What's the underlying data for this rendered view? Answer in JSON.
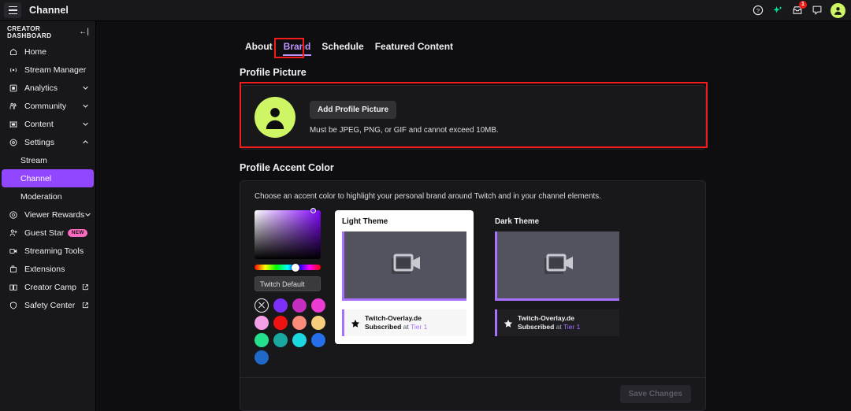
{
  "topbar": {
    "title": "Channel",
    "menu_icon": "hamburger-icon",
    "icons": [
      {
        "name": "help-icon",
        "label": "Help"
      },
      {
        "name": "sparkle-icon",
        "label": "Prime Loot"
      },
      {
        "name": "inbox-icon",
        "label": "Inbox",
        "badge": "1"
      },
      {
        "name": "whispers-icon",
        "label": "Whispers"
      }
    ],
    "avatar_bg": "#cdf564"
  },
  "sidebar": {
    "heading": "CREATOR DASHBOARD",
    "collapse_icon": "collapse-left-icon",
    "items": [
      {
        "label": "Home",
        "icon": "home-icon",
        "expandable": false
      },
      {
        "label": "Stream Manager",
        "icon": "broadcast-icon",
        "expandable": false
      },
      {
        "label": "Analytics",
        "icon": "analytics-icon",
        "expandable": true
      },
      {
        "label": "Community",
        "icon": "community-icon",
        "expandable": true
      },
      {
        "label": "Content",
        "icon": "content-icon",
        "expandable": true
      },
      {
        "label": "Settings",
        "icon": "gear-icon",
        "expandable": true,
        "expanded": true
      }
    ],
    "settings_children": [
      {
        "label": "Stream",
        "active": false
      },
      {
        "label": "Channel",
        "active": true
      },
      {
        "label": "Moderation",
        "active": false
      }
    ],
    "items_after": [
      {
        "label": "Viewer Rewards",
        "icon": "rewards-icon",
        "expandable": true
      },
      {
        "label": "Guest Star",
        "icon": "guest-star-icon",
        "badge": "NEW"
      },
      {
        "label": "Streaming Tools",
        "icon": "camera-icon"
      },
      {
        "label": "Extensions",
        "icon": "extensions-icon"
      },
      {
        "label": "Creator Camp",
        "icon": "book-icon",
        "external": true
      },
      {
        "label": "Safety Center",
        "icon": "shield-icon",
        "external": true
      }
    ],
    "active_bg": "#9147ff",
    "new_badge_bg": "#ff6ac1"
  },
  "tabs": [
    {
      "label": "About",
      "active": false
    },
    {
      "label": "Brand",
      "active": true
    },
    {
      "label": "Schedule",
      "active": false
    },
    {
      "label": "Featured Content",
      "active": false
    }
  ],
  "profile_picture": {
    "section_title": "Profile Picture",
    "button_label": "Add Profile Picture",
    "hint": "Must be JPEG, PNG, or GIF and cannot exceed 10MB.",
    "avatar_bg": "#cdf564"
  },
  "accent_color": {
    "section_title": "Profile Accent Color",
    "description": "Choose an accent color to highlight your personal brand around Twitch and in your channel elements.",
    "input_value": "Twitch Default",
    "swatches": [
      {
        "name": "no-color",
        "color": "none",
        "selected": true
      },
      {
        "name": "purple",
        "color": "#7b2ff7"
      },
      {
        "name": "magenta-purple",
        "color": "#c42ec0"
      },
      {
        "name": "pink-magenta",
        "color": "#ee3bd1"
      },
      {
        "name": "light-pink",
        "color": "#f39fe8"
      },
      {
        "name": "red",
        "color": "#ee1212"
      },
      {
        "name": "salmon",
        "color": "#f88b7a"
      },
      {
        "name": "light-orange",
        "color": "#f7ce7c"
      },
      {
        "name": "spring-green",
        "color": "#22e08c"
      },
      {
        "name": "teal",
        "color": "#1aa7a0"
      },
      {
        "name": "cyan",
        "color": "#1ad7e0"
      },
      {
        "name": "blue",
        "color": "#2570e8"
      },
      {
        "name": "dark-blue",
        "color": "#2169c9"
      }
    ],
    "accent_preview_color": "#a970ff",
    "themes": [
      {
        "label": "Light Theme",
        "mode": "light",
        "notif_title": "Twitch-Overlay.de",
        "notif_sub_bold": "Subscribed",
        "notif_sub_mid": " at ",
        "notif_sub_tier": "Tier 1"
      },
      {
        "label": "Dark Theme",
        "mode": "dark",
        "notif_title": "Twitch-Overlay.de",
        "notif_sub_bold": "Subscribed",
        "notif_sub_mid": " at ",
        "notif_sub_tier": "Tier 1"
      }
    ],
    "save_label": "Save Changes",
    "save_disabled": true
  }
}
